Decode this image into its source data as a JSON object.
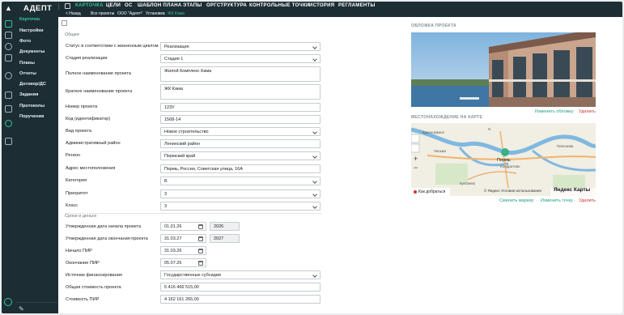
{
  "app": {
    "brand": "АДЕПТ"
  },
  "topnav": {
    "tabs": [
      "КАРТОЧКА",
      "ЦЕЛИ",
      "ОС",
      "ШАБЛОН ПЛАНА",
      "ЭТАПЫ",
      "ОРГСТРУКТУРА",
      "КОНТРОЛЬНЫЕ ТОЧКИ",
      "ИСТОРИЯ",
      "РЕГЛАМЕНТЫ"
    ],
    "active": "КАРТОЧКА"
  },
  "breadcrumb": {
    "back": "< Назад",
    "items": [
      "Все проекты",
      "ООО \"Адепт\"",
      "Установка",
      "ЖК Кама"
    ]
  },
  "sidebar": {
    "items": [
      "Карточка",
      "Настройки",
      "Фото",
      "Документы",
      "Планы",
      "Отчеты",
      "Договор/ДС",
      "Задания",
      "Протоколы",
      "Поручения"
    ],
    "active": "Карточка"
  },
  "form": {
    "section_general": "Общее",
    "section_deadlines": "Сроки и деньги",
    "fields": {
      "status_lifecycle": {
        "label": "Статус в соответствии с жизненным циклом",
        "value": "Реализация"
      },
      "stage": {
        "label": "Стадия реализации",
        "value": "Стадия 1"
      },
      "full_name": {
        "label": "Полное наименование проекта",
        "value": "Жилой Комплекс Кама"
      },
      "short_name": {
        "label": "Краткое наименование проекта",
        "value": "ЖК Кама"
      },
      "number": {
        "label": "Номер проекта",
        "value": "123У"
      },
      "code": {
        "label": "Код (идентификатор)",
        "value": "1568-14"
      },
      "type": {
        "label": "Вид проекта",
        "value": "Новое строительство"
      },
      "district": {
        "label": "Административный район",
        "value": "Ленинский район"
      },
      "region": {
        "label": "Регион",
        "value": "Пермский край"
      },
      "address": {
        "label": "Адрес местоположения",
        "value": "Пермь, Россия, Советская улица, 16А"
      },
      "category": {
        "label": "Категория",
        "value": "В"
      },
      "priority": {
        "label": "Приоритет",
        "value": "3"
      },
      "class": {
        "label": "Класс",
        "value": "3"
      },
      "approved_start": {
        "label": "Утвержденная дата начала проекта",
        "value": "01.01.26",
        "year": "2026"
      },
      "approved_end": {
        "label": "Утвержденная дата окончания проекта",
        "value": "31.03.27",
        "year": "2027"
      },
      "pir_start": {
        "label": "Начало ПИР",
        "value": "31.03.26"
      },
      "pir_end": {
        "label": "Окончание ПИР",
        "value": "05.07.26"
      },
      "funding": {
        "label": "Источник финансирования",
        "value": "Государственные субсидии"
      },
      "total_cost": {
        "label": "Общая стоимость проекта",
        "value": "5 416 466 515,00"
      },
      "pir_cost": {
        "label": "Стоимость ПИР",
        "value": "4 162 161 265,00"
      }
    }
  },
  "cover": {
    "title": "ОБЛОЖКА ПРОЕКТА",
    "change": "Изменить обложку",
    "delete": "Удалить"
  },
  "location": {
    "title": "МЕСТОНАХОЖДЕНИЕ НА КАРТЕ",
    "route": "Как добраться",
    "copyright": "© Яндекс Условия использования",
    "provider": "Яндекс Карты",
    "city": "Пермь",
    "places": [
      "Краснокамск",
      "Кондратово",
      "Култаево",
      "Пальники",
      "Ласьва",
      "Н."
    ],
    "zoom_in": "+",
    "zoom_out": "−",
    "change_marker": "Сменить маркер",
    "change_point": "Изменить точку",
    "delete": "Удалить"
  },
  "colors": {
    "nav_bg": "#1c2e34",
    "accent": "#37c29a",
    "danger": "#d0342c"
  }
}
